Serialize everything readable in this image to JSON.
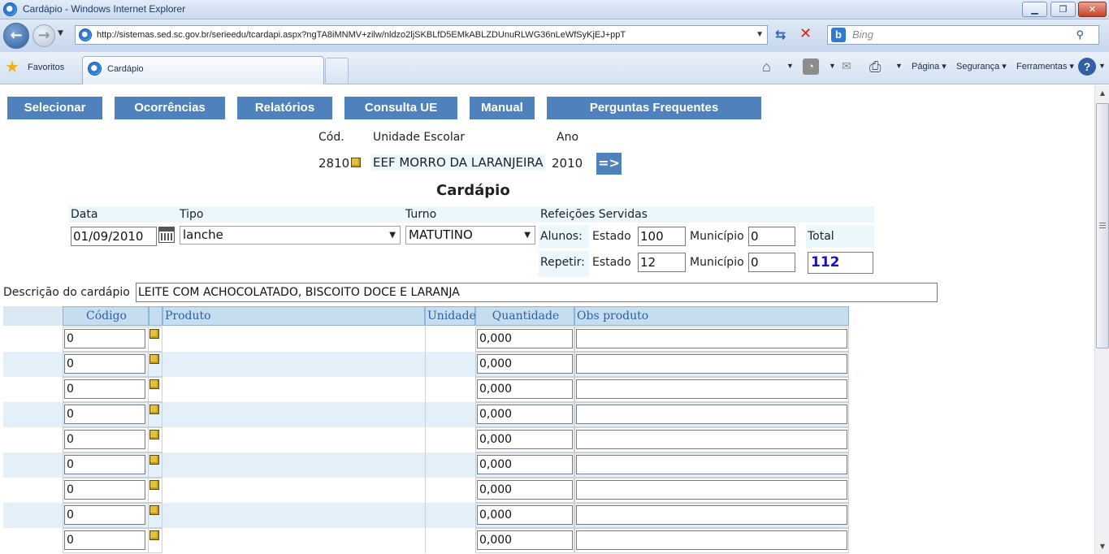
{
  "browser": {
    "title": "Cardápio - Windows Internet Explorer",
    "url": "http://sistemas.sed.sc.gov.br/serieedu/tcardapi.aspx?ngTA8iMNMV+zilw/nldzo2ljSKBLfD5EMkABLZDUnuRLWG36nLeWfSyKjEJ+ppT",
    "search_placeholder": "Bing",
    "favorites_label": "Favoritos",
    "tab_title": "Cardápio",
    "menu_pagina": "Página ▾",
    "menu_seguranca": "Segurança ▾",
    "menu_ferramentas": "Ferramentas ▾"
  },
  "nav": {
    "selecionar": "Selecionar",
    "ocorrencias": "Ocorrências",
    "relatorios": "Relatórios",
    "consulta_ue": "Consulta UE",
    "manual": "Manual",
    "perguntas": "Perguntas Frequentes"
  },
  "school": {
    "cod_label": "Cód.",
    "unidade_label": "Unidade Escolar",
    "ano_label": "Ano",
    "cod": "2810",
    "unidade": "EEF MORRO DA LARANJEIRA",
    "ano": "2010",
    "go_button": "=>"
  },
  "form": {
    "heading": "Cardápio",
    "data_label": "Data",
    "data": "01/09/2010",
    "tipo_label": "Tipo",
    "tipo": "lanche",
    "turno_label": "Turno",
    "turno": "MATUTINO",
    "refeicoes_label": "Refeições Servidas",
    "alunos_label": "Alunos:",
    "estado_label": "Estado",
    "municipio_label": "Município",
    "alunos_estado": "100",
    "alunos_municipio": "0",
    "repetir_label": "Repetir:",
    "repetir_estado": "12",
    "repetir_municipio": "0",
    "total_label": "Total",
    "total": "112",
    "descricao_label": "Descrição do cardápio",
    "descricao": "LEITE COM ACHOCOLATADO, BISCOITO DOCE E LARANJA"
  },
  "grid": {
    "headers": [
      "Código",
      "Produto",
      "Unidade",
      "Quantidade",
      "Obs produto"
    ],
    "rows": [
      {
        "codigo": "0",
        "quantidade": "0,000"
      },
      {
        "codigo": "0",
        "quantidade": "0,000"
      },
      {
        "codigo": "0",
        "quantidade": "0,000"
      },
      {
        "codigo": "0",
        "quantidade": "0,000"
      },
      {
        "codigo": "0",
        "quantidade": "0,000"
      },
      {
        "codigo": "0",
        "quantidade": "0,000"
      },
      {
        "codigo": "0",
        "quantidade": "0,000"
      },
      {
        "codigo": "0",
        "quantidade": "0,000"
      },
      {
        "codigo": "0",
        "quantidade": "0,000"
      }
    ]
  }
}
